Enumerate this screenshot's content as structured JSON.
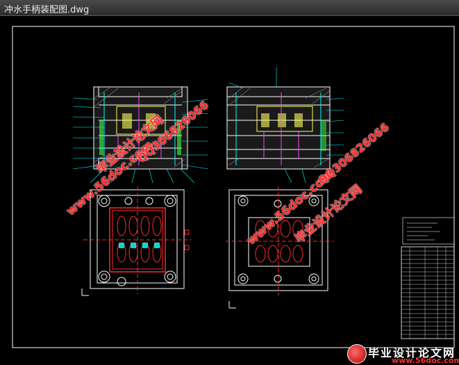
{
  "window": {
    "title": "冲水手柄装配图.dwg"
  },
  "watermarks": {
    "site": "www.56doc.com",
    "cn_name": "毕业设计论文网",
    "qq": "QQ306826066"
  },
  "footer": {
    "cn_name": "毕业设计论文网",
    "site": "www.56doc.com"
  },
  "colors": {
    "line": "#ffffff",
    "dim": "#00ffff",
    "red": "#ff2a2a",
    "yellow": "#ffff55",
    "magenta": "#ff44ff",
    "green": "#44ff44"
  }
}
